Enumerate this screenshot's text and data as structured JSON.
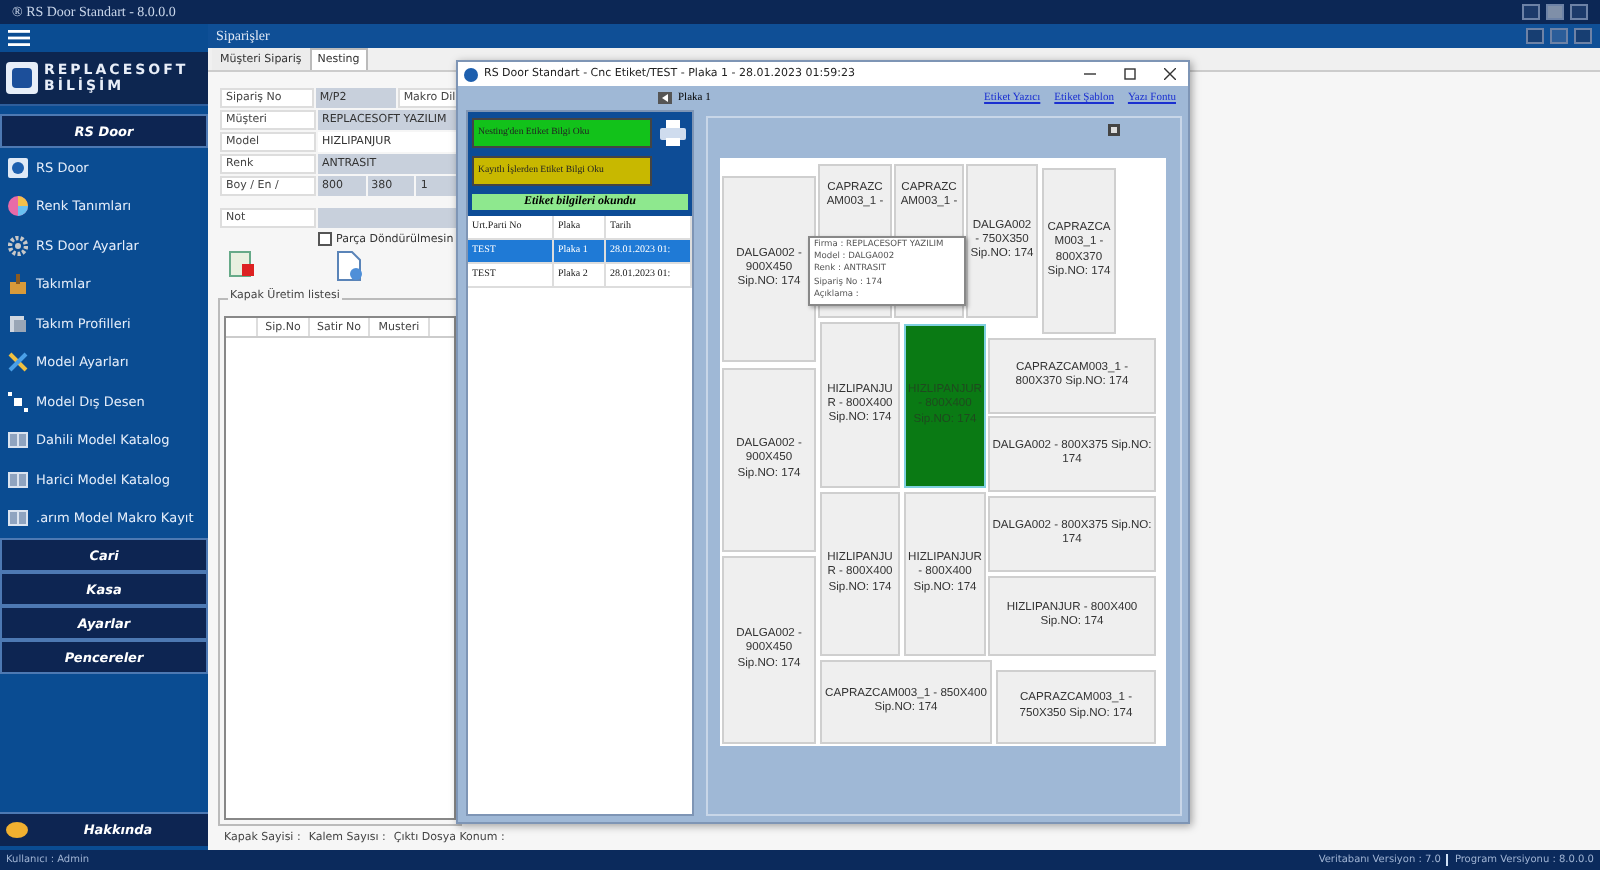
{
  "app_title": "® RS Door Standart - 8.0.0.0",
  "sidebar": {
    "logo": {
      "line1": "REPLACESOFT",
      "line2": "BİLİŞİM"
    },
    "sections": [
      {
        "title": "RS Door",
        "items": [
          {
            "label": "RS Door",
            "kind": "app"
          },
          {
            "label": "Renk Tanımları",
            "kind": "color"
          },
          {
            "label": "RS Door Ayarlar",
            "kind": "gear"
          },
          {
            "label": "Takımlar",
            "kind": "tool"
          },
          {
            "label": "Takım Profilleri",
            "kind": "profile"
          },
          {
            "label": "Model Ayarları",
            "kind": "cross"
          },
          {
            "label": "Model Dış Desen",
            "kind": "pattern"
          },
          {
            "label": "Dahili Model Katalog",
            "kind": "catalog"
          },
          {
            "label": "Harici Model Katalog",
            "kind": "catalog"
          },
          {
            "label": ".arım Model Makro Kayıt",
            "kind": "catalog"
          }
        ]
      },
      {
        "title": "Cari"
      },
      {
        "title": "Kasa"
      },
      {
        "title": "Ayarlar"
      },
      {
        "title": "Pencereler"
      }
    ],
    "about": "Hakkında"
  },
  "main": {
    "title": "Siparişler",
    "tabs": [
      {
        "label": "Müşteri Sipariş",
        "selected": false
      },
      {
        "label": "Nesting",
        "selected": true
      }
    ],
    "form": {
      "order_no_label": "Sipariş No",
      "order_no": "M/P2",
      "macro_label": "Makro Dil",
      "customer_label": "Müşteri",
      "customer": "REPLACESOFT YAZILIM",
      "model_label": "Model",
      "model": "HIZLIPANJUR",
      "color_label": "Renk",
      "color_name": "ANTRASIT",
      "size_label": "Boy / En /",
      "size": [
        "800",
        "380",
        "1"
      ],
      "note_label": "Not",
      "rotate": {
        "label": "Parça Döndürülmesin",
        "checked": false
      }
    },
    "list": {
      "title": "Kapak Üretim listesi",
      "columns": [
        "Sip.No",
        "Satir No",
        "Musteri"
      ]
    },
    "status": [
      "Kapak Sayisi :",
      "Kalem Sayısı :",
      "Çıktı Dosya Konum :"
    ]
  },
  "dialog": {
    "title": "RS Door Standart - Cnc Etiket/TEST - Plaka 1 - 28.01.2023 01:59:23",
    "plate": "Plaka 1",
    "links": [
      "Etiket Yazıcı",
      "Etiket Şablon",
      "Yazı Fontu"
    ],
    "read_nesting": "Nesting'den Etiket Bilgi Oku",
    "read_saved": "Kayıtlı İşlerden Etiket Bilgi Oku",
    "info": "Etiket bilgileri okundu",
    "table": {
      "columns": [
        "Urt.Parti No",
        "Plaka",
        "Tarih"
      ],
      "rows": [
        {
          "cells": [
            "TEST",
            "Plaka 1",
            "28.01.2023 01:"
          ],
          "selected": true
        },
        {
          "cells": [
            "TEST",
            "Plaka 2",
            "28.01.2023 01:"
          ],
          "selected": false
        }
      ]
    },
    "pieces": [
      {
        "text": "DALGA002 - 900X450 Sip.NO:   174",
        "selected": false
      },
      {
        "text": "CAPRAZC AM003_1 -",
        "selected": false
      },
      {
        "text": "CAPRAZC AM003_1 -",
        "selected": false
      },
      {
        "text": "DALGA002 - 750X350 Sip.NO: 174",
        "selected": false
      },
      {
        "text": "CAPRAZCA M003_1 - 800X370 Sip.NO: 174",
        "selected": false
      },
      {
        "text": "DALGA002 - 900X450 Sip.NO:   174",
        "selected": false
      },
      {
        "text": "HIZLIPANJUR - 800X400 Sip.NO:   174",
        "selected": false
      },
      {
        "text": "HIZLIPANJUR - 800X400 Sip.NO:   174",
        "selected": true
      },
      {
        "text": "CAPRAZCAM003_1 - 800X370 Sip.NO:   174",
        "selected": false
      },
      {
        "text": "DALGA002 - 800X375 Sip.NO:   174",
        "selected": false
      },
      {
        "text": "HIZLIPANJUR - 800X400 Sip.NO:   174",
        "selected": false
      },
      {
        "text": "HIZLIPANJUR - 800X400 Sip.NO:   174",
        "selected": false
      },
      {
        "text": "DALGA002 - 800X375 Sip.NO:   174",
        "selected": false
      },
      {
        "text": "HIZLIPANJUR - 800X400 Sip.NO:   174",
        "selected": false
      },
      {
        "text": "DALGA002 - 900X450 Sip.NO:   174",
        "selected": false
      },
      {
        "text": "CAPRAZCAM003_1 - 850X400 Sip.NO:   174",
        "selected": false
      },
      {
        "text": "CAPRAZCAM003_1 - 750X350 Sip.NO:   174",
        "selected": false
      }
    ],
    "tooltip": [
      "Firma : REPLACESOFT YAZILIM",
      "Model : DALGA002",
      "Renk : ANTRASIT",
      "Sipariş No : 174",
      "Açıklama :"
    ]
  },
  "footer": {
    "user": "Kullanıcı : Admin",
    "versions": [
      "Veritabanı Versiyon : 7.0",
      "Program Versiyonu : 8.0.0.0"
    ]
  }
}
